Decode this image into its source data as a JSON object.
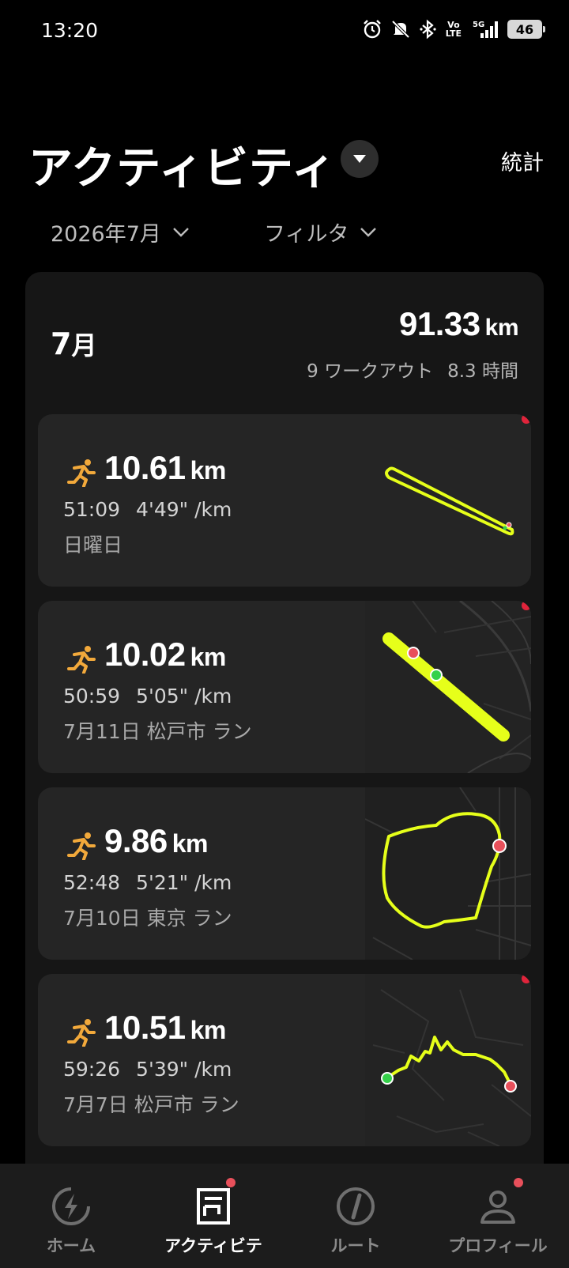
{
  "status_bar": {
    "time": "13:20",
    "battery": "46",
    "network": "5G",
    "volte_top": "Vo",
    "volte_bottom": "LTE"
  },
  "header": {
    "title": "アクティビティ",
    "stats_label": "統計"
  },
  "filters": {
    "month_label": "2026年7月",
    "filter_label": "フィルタ"
  },
  "summary": {
    "month_num": "7",
    "month_unit": "月",
    "distance": "91.33",
    "distance_unit": "km",
    "workouts": "9 ワークアウト",
    "duration": "8.3 時間"
  },
  "activities": [
    {
      "distance": "10.61",
      "unit": "km",
      "time": "51:09",
      "pace": "4'49\" /km",
      "label": "日曜日",
      "is_new": true,
      "map": "straight-route"
    },
    {
      "distance": "10.02",
      "unit": "km",
      "time": "50:59",
      "pace": "5'05\" /km",
      "label": "7月11日  松戸市 ラン",
      "is_new": true,
      "map": "river-route"
    },
    {
      "distance": "9.86",
      "unit": "km",
      "time": "52:48",
      "pace": "5'21\" /km",
      "label": "7月10日  東京 ラン",
      "is_new": false,
      "map": "loop-route"
    },
    {
      "distance": "10.51",
      "unit": "km",
      "time": "59:26",
      "pace": "5'39\" /km",
      "label": "7月7日  松戸市 ラン",
      "is_new": true,
      "map": "street-route"
    }
  ],
  "nav": [
    {
      "label": "ホーム",
      "icon": "bolt-icon",
      "active": false,
      "badge": false
    },
    {
      "label": "アクティビテ",
      "icon": "activity-list-icon",
      "active": true,
      "badge": true
    },
    {
      "label": "ルート",
      "icon": "compass-icon",
      "active": false,
      "badge": false
    },
    {
      "label": "プロフィール",
      "icon": "person-icon",
      "active": false,
      "badge": true
    }
  ],
  "colors": {
    "route": "#e6ff1a",
    "accent_runner": "#f2a93b",
    "badge": "#e8505b"
  }
}
